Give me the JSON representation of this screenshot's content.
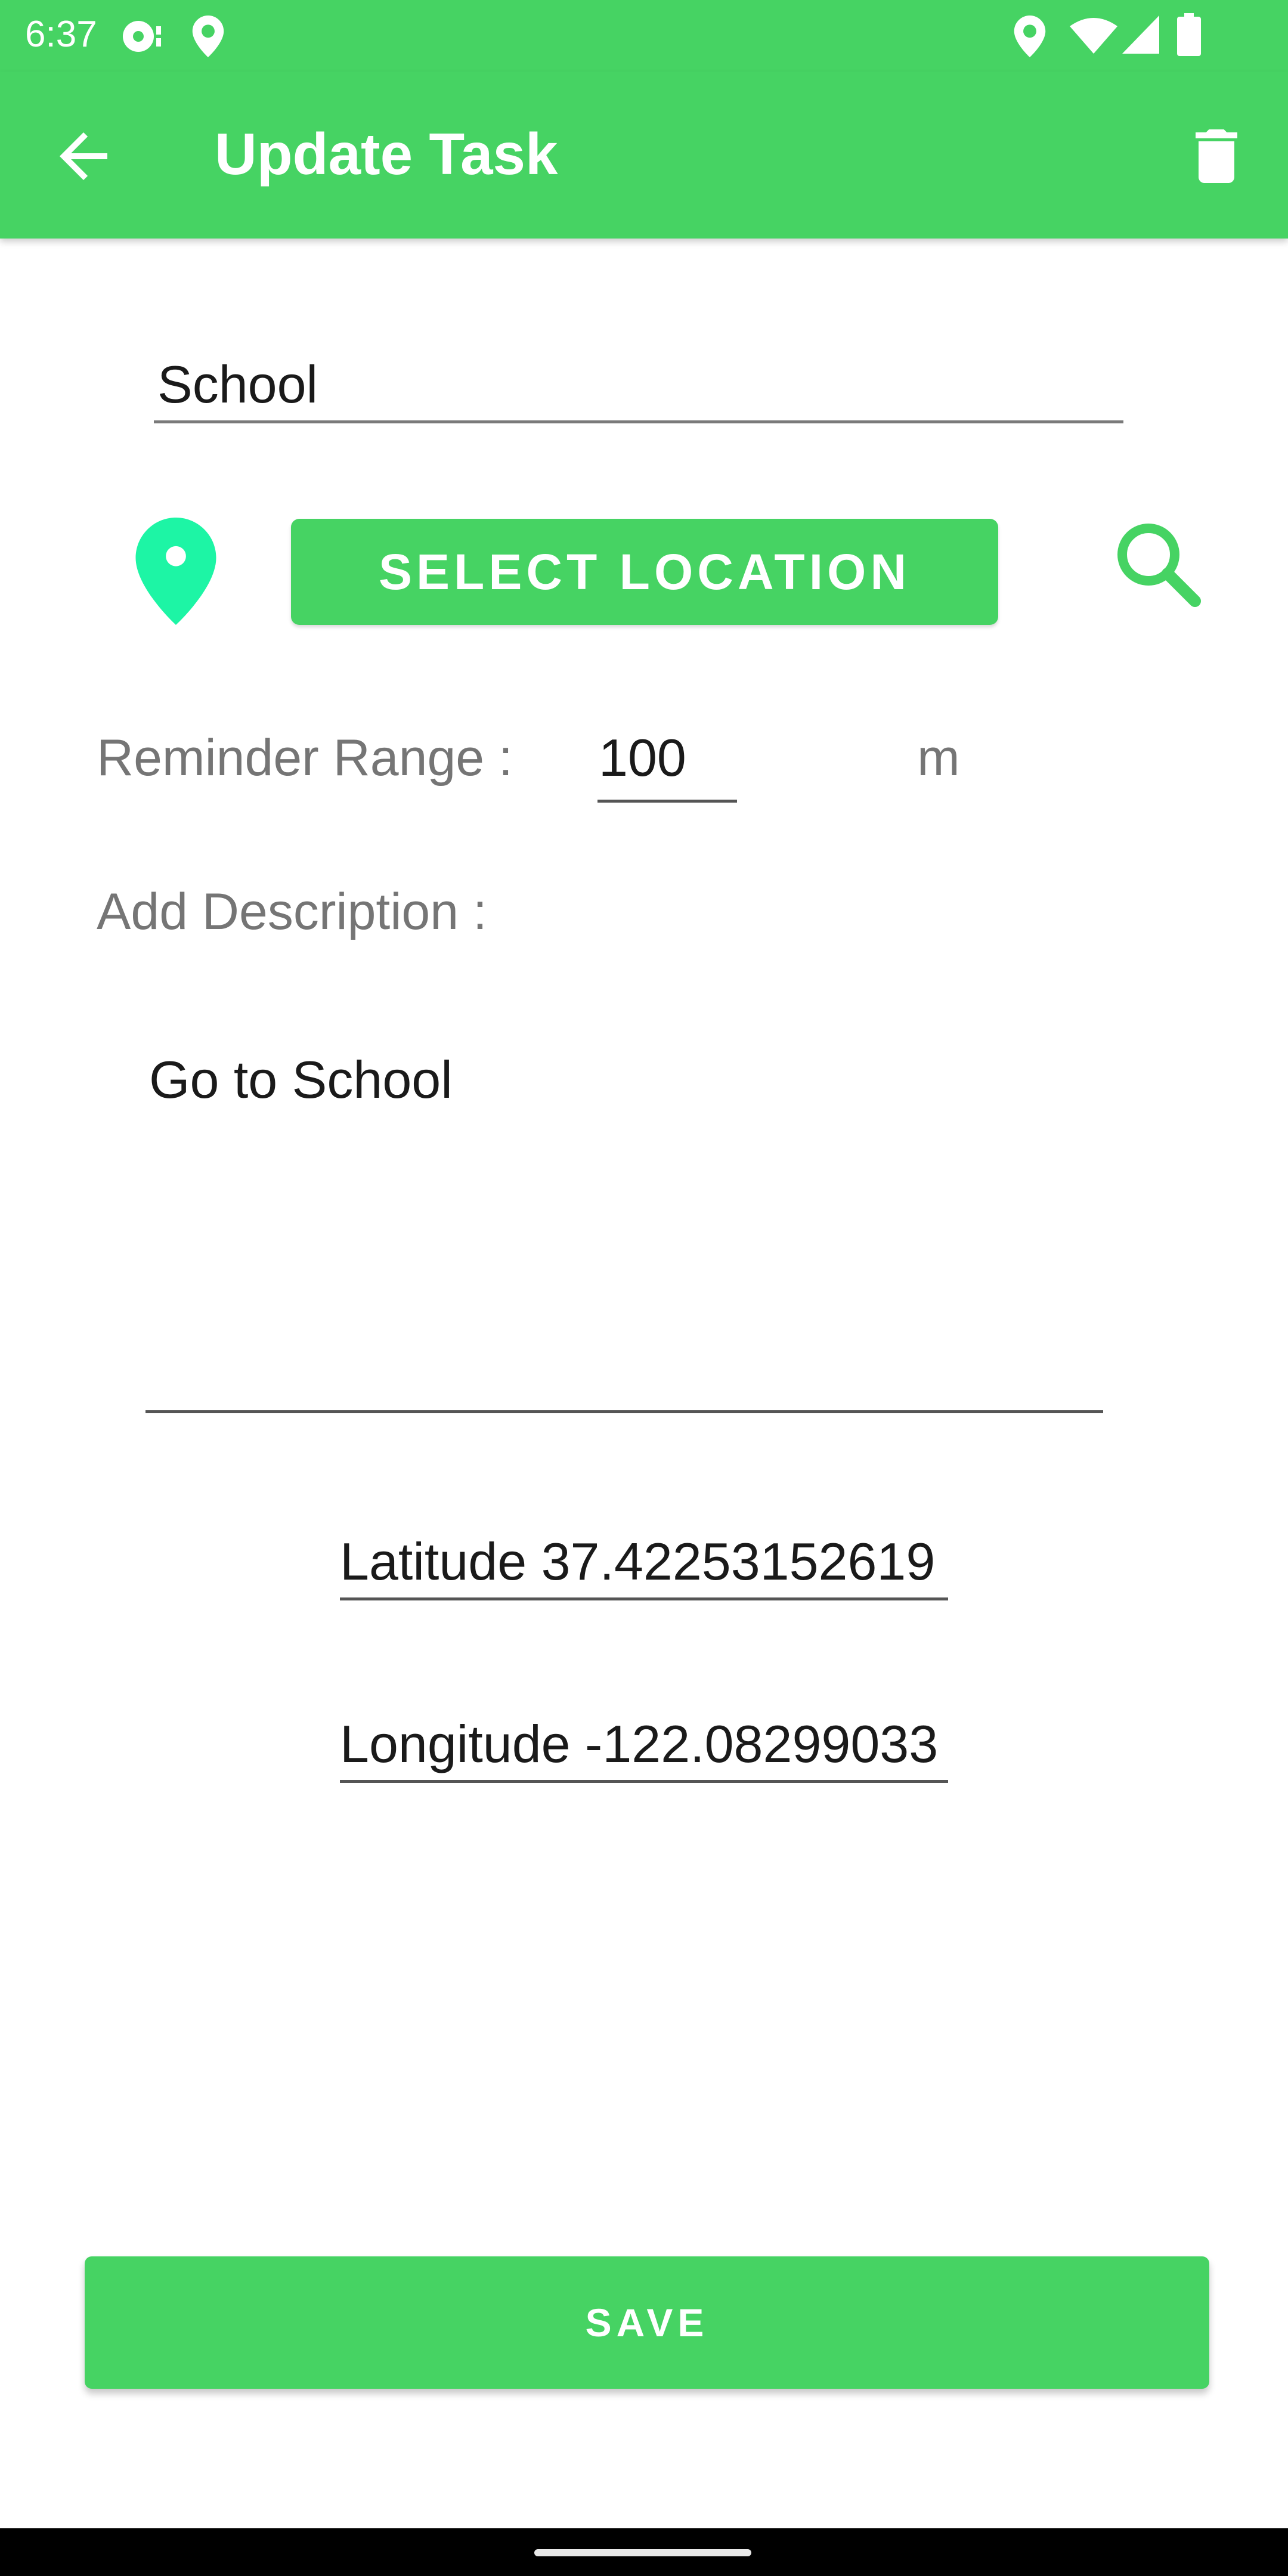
{
  "status_bar": {
    "time": "6:37",
    "icons": [
      "media-icon",
      "location-icon",
      "location-icon",
      "wifi-icon",
      "signal-icon",
      "battery-icon"
    ]
  },
  "app_bar": {
    "title": "Update Task",
    "back_icon": "arrow-back-icon",
    "delete_icon": "trash-icon",
    "background_color": "#46d363"
  },
  "form": {
    "task_name_value": "School",
    "select_location_label": "SELECT LOCATION",
    "pin_icon_color": "#1df5a5",
    "search_icon_color": "#46d363",
    "reminder_range_label": "Reminder Range :",
    "reminder_range_value": "100",
    "reminder_range_unit": "m",
    "description_label": "Add Description :",
    "description_value": "Go to School",
    "latitude_value": "Latitude 37.42253152619",
    "longitude_value": "Longitude -122.08299033",
    "save_label": "SAVE"
  }
}
